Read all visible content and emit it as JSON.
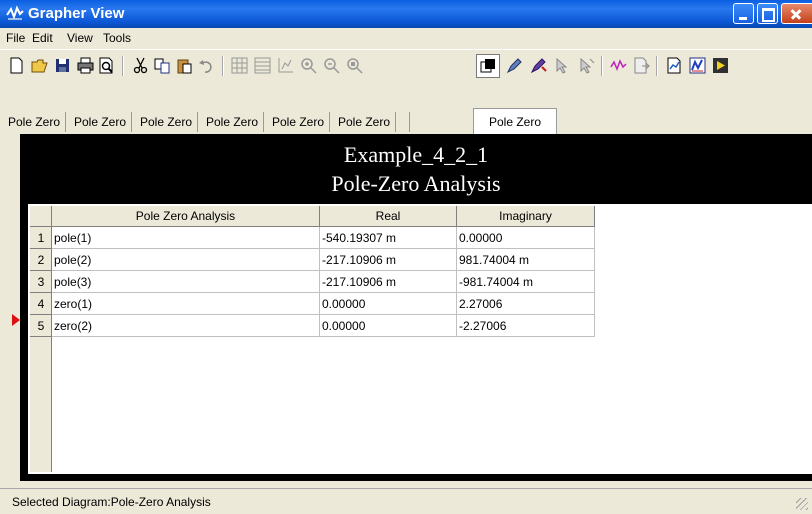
{
  "window": {
    "title": "Grapher View"
  },
  "menu": [
    "File",
    "Edit",
    "View",
    "Tools"
  ],
  "toolbar": {
    "icons": [
      "new-icon",
      "open-icon",
      "save-icon",
      "print-icon",
      "print-preview-icon",
      "cut-icon",
      "copy-icon",
      "paste-icon",
      "undo-icon",
      "grid-icon",
      "list-icon",
      "axis-icon",
      "zoom-in-icon",
      "zoom-out-icon",
      "zoom-fit-icon",
      "overlay-icon",
      "pen-icon",
      "marker-icon",
      "cursor-icon",
      "cursor2-icon",
      "waveform-icon",
      "export-icon",
      "page-icon",
      "chart-icon",
      "run-icon"
    ]
  },
  "tabs": [
    "Pole Zero",
    "Pole Zero",
    "Pole Zero",
    "Pole Zero",
    "Pole Zero",
    "Pole Zero",
    "Pole Zero"
  ],
  "active_tab": 6,
  "chart": {
    "title": "Example_4_2_1",
    "subtitle": "Pole-Zero Analysis"
  },
  "table": {
    "headers": [
      "Pole Zero Analysis",
      "Real",
      "Imaginary"
    ],
    "rows": [
      {
        "num": "1",
        "name": "pole(1)",
        "real": "-540.19307 m",
        "imag": "0.00000"
      },
      {
        "num": "2",
        "name": "pole(2)",
        "real": "-217.10906 m",
        "imag": "981.74004 m"
      },
      {
        "num": "3",
        "name": "pole(3)",
        "real": "-217.10906 m",
        "imag": "-981.74004 m"
      },
      {
        "num": "4",
        "name": "zero(1)",
        "real": "0.00000",
        "imag": "2.27006"
      },
      {
        "num": "5",
        "name": "zero(2)",
        "real": "0.00000",
        "imag": "-2.27006"
      }
    ]
  },
  "status": {
    "text": "Selected Diagram:Pole-Zero Analysis"
  }
}
